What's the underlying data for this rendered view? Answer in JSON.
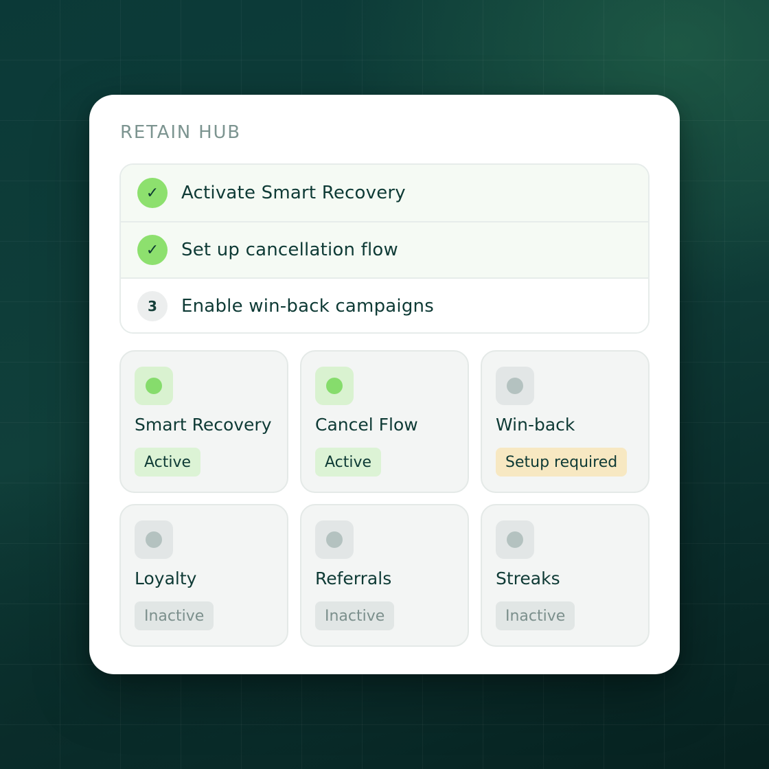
{
  "hub": {
    "title": "RETAIN HUB"
  },
  "steps": [
    {
      "status": "done",
      "marker": "✓",
      "label": "Activate Smart Recovery"
    },
    {
      "status": "done",
      "marker": "✓",
      "label": "Set up cancellation flow"
    },
    {
      "status": "todo",
      "marker": "3",
      "label": "Enable win-back campaigns"
    }
  ],
  "tiles": [
    {
      "name": "Smart Recovery",
      "badge": "Active",
      "status": "active"
    },
    {
      "name": "Cancel Flow",
      "badge": "Active",
      "status": "active"
    },
    {
      "name": "Win-back",
      "badge": "Setup required",
      "status": "setup"
    },
    {
      "name": "Loyalty",
      "badge": "Inactive",
      "status": "inactive"
    },
    {
      "name": "Referrals",
      "badge": "Inactive",
      "status": "inactive"
    },
    {
      "name": "Streaks",
      "badge": "Inactive",
      "status": "inactive"
    }
  ],
  "colors": {
    "active_icon_bg": "#d9f2d0",
    "active_dot": "#86dc6c",
    "active_badge_bg": "#dcf3d5",
    "active_badge_text": "#0e3a35",
    "setup_icon_bg": "#e2e6e6",
    "setup_dot": "#b4c2c0",
    "setup_badge_bg": "#f7e8c2",
    "setup_badge_text": "#0e3a35",
    "inactive_icon_bg": "#e2e6e6",
    "inactive_dot": "#b4c2c0",
    "inactive_badge_bg": "#e1e6e5",
    "inactive_badge_text": "#7b8f8c"
  }
}
